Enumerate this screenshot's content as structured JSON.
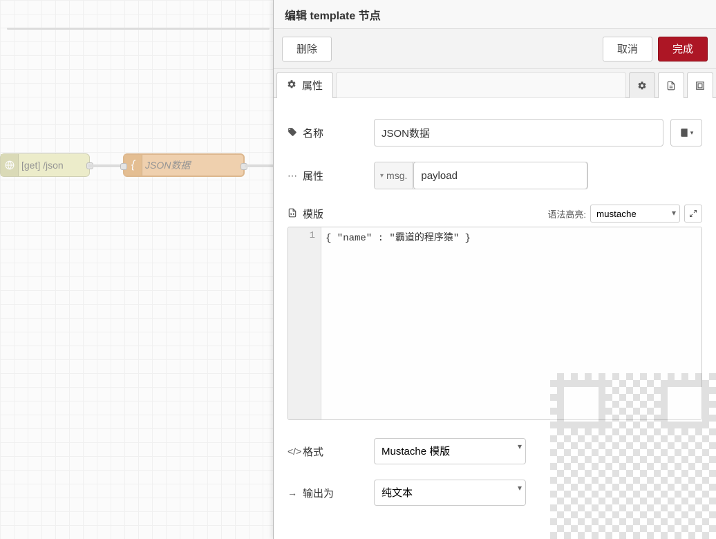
{
  "workspace": {
    "http_node_label": "[get] /json",
    "template_node_label": "JSON数据"
  },
  "panel": {
    "title": "编辑 template 节点",
    "delete_label": "删除",
    "cancel_label": "取消",
    "done_label": "完成",
    "tabs": {
      "properties_label": "属性"
    }
  },
  "form": {
    "name": {
      "label": "名称",
      "value": "JSON数据"
    },
    "property": {
      "label": "属性",
      "type_prefix": "msg.",
      "value": "payload"
    },
    "template": {
      "label": "模版",
      "syntax_label": "语法高亮:",
      "syntax_value": "mustache",
      "line_number": "1",
      "code_text": "{ \"name\" : \"霸道的程序猿\" }"
    },
    "format": {
      "label": "格式",
      "value": "Mustache 模版"
    },
    "output": {
      "label": "输出为",
      "value": "纯文本"
    }
  }
}
